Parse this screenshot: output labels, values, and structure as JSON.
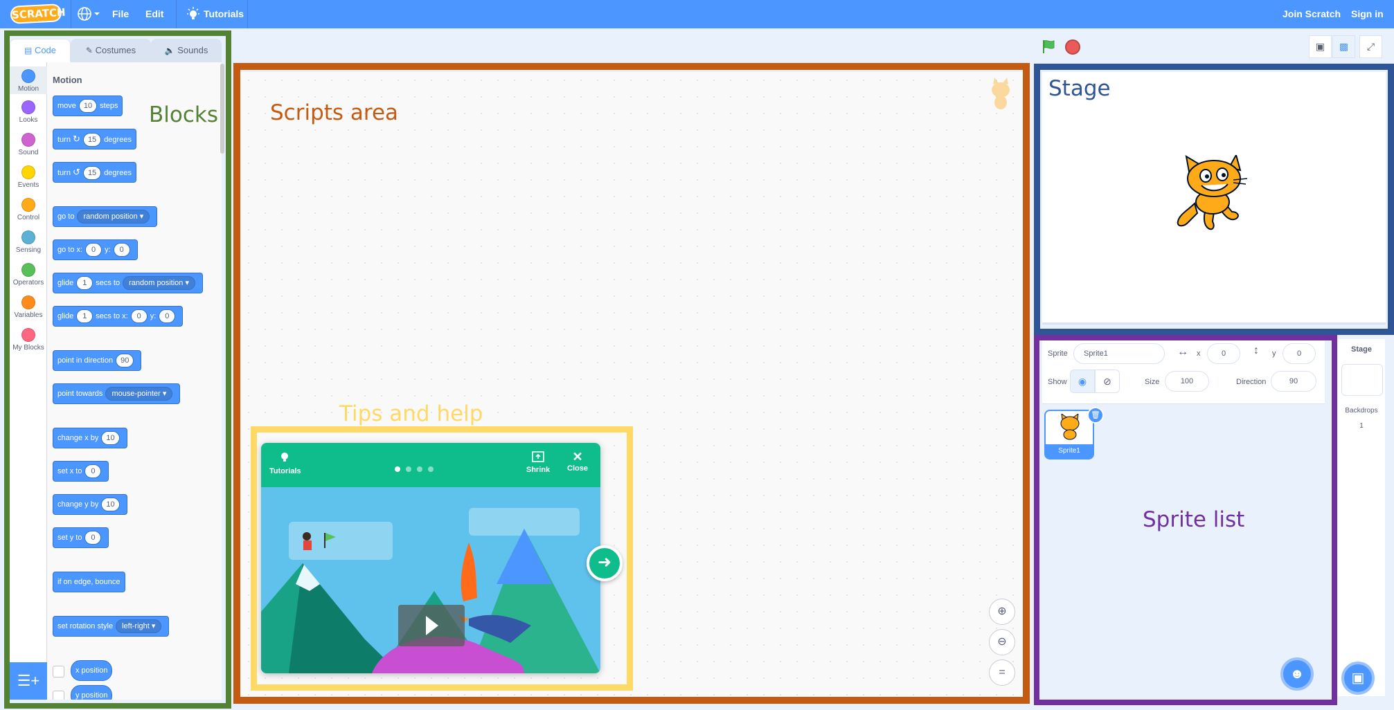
{
  "menubar": {
    "logo": "SCRATCH",
    "file": "File",
    "edit": "Edit",
    "tutorials": "Tutorials",
    "join": "Join Scratch",
    "signin": "Sign in"
  },
  "tabs": {
    "code": "Code",
    "costumes": "Costumes",
    "sounds": "Sounds"
  },
  "categories": [
    {
      "label": "Motion",
      "color": "#4c97ff"
    },
    {
      "label": "Looks",
      "color": "#9966ff"
    },
    {
      "label": "Sound",
      "color": "#cf63cf"
    },
    {
      "label": "Events",
      "color": "#ffd500"
    },
    {
      "label": "Control",
      "color": "#ffab19"
    },
    {
      "label": "Sensing",
      "color": "#5cb1d6"
    },
    {
      "label": "Operators",
      "color": "#59c059"
    },
    {
      "label": "Variables",
      "color": "#ff8c1a"
    },
    {
      "label": "My Blocks",
      "color": "#ff6680"
    }
  ],
  "palette": {
    "title": "Motion",
    "move": {
      "a": "move",
      "v": "10",
      "b": "steps"
    },
    "turn_right": {
      "a": "turn",
      "icon": "↻",
      "v": "15",
      "b": "degrees"
    },
    "turn_left": {
      "a": "turn",
      "icon": "↺",
      "v": "15",
      "b": "degrees"
    },
    "goto": {
      "a": "go to",
      "dd": "random position"
    },
    "gotoxy": {
      "a": "go to x:",
      "x": "0",
      "b": "y:",
      "y": "0"
    },
    "glide_to": {
      "a": "glide",
      "v": "1",
      "b": "secs to",
      "dd": "random position"
    },
    "glide_xy": {
      "a": "glide",
      "v": "1",
      "b": "secs to x:",
      "x": "0",
      "c": "y:",
      "y": "0"
    },
    "point_dir": {
      "a": "point in direction",
      "v": "90"
    },
    "point_towards": {
      "a": "point towards",
      "dd": "mouse-pointer"
    },
    "change_x": {
      "a": "change x by",
      "v": "10"
    },
    "set_x": {
      "a": "set x to",
      "v": "0"
    },
    "change_y": {
      "a": "change y by",
      "v": "10"
    },
    "set_y": {
      "a": "set y to",
      "v": "0"
    },
    "bounce": "if on edge, bounce",
    "rot_style": {
      "a": "set rotation style",
      "dd": "left-right"
    },
    "x_pos": "x position",
    "y_pos": "y position"
  },
  "tutorial": {
    "tutorials": "Tutorials",
    "shrink": "Shrink",
    "close": "Close"
  },
  "sprite_info": {
    "sprite_label": "Sprite",
    "sprite_name": "Sprite1",
    "x_label": "x",
    "x": "0",
    "y_label": "y",
    "y": "0",
    "show_label": "Show",
    "size_label": "Size",
    "size": "100",
    "direction_label": "Direction",
    "direction": "90"
  },
  "sprite_list": {
    "thumb_name": "Sprite1"
  },
  "stage_pane": {
    "title": "Stage",
    "backdrops_label": "Backdrops",
    "backdrops_count": "1"
  },
  "annotations": {
    "blocks": "Blocks",
    "scripts": "Scripts area",
    "tips": "Tips and help",
    "stage": "Stage",
    "sprites": "Sprite list"
  },
  "colors": {
    "blocks_frame": "#548235",
    "scripts_frame": "#c55a11",
    "tips_frame": "#ffd966",
    "stage_frame": "#2f5597",
    "sprites_frame": "#7030a0"
  }
}
